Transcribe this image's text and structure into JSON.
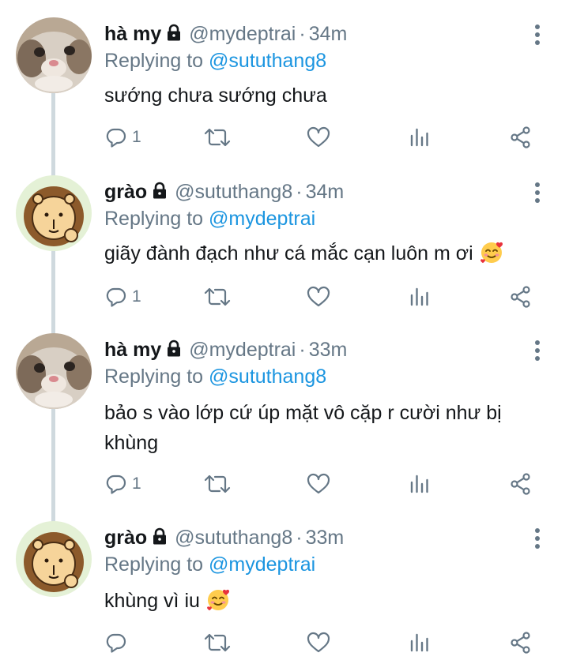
{
  "tweets": [
    {
      "name": "hà my",
      "handle": "@mydeptrai",
      "separator": "·",
      "time": "34m",
      "replying_prefix": "Replying to",
      "replying_to": "@sututhang8",
      "text": "sướng chưa sướng chưa",
      "reply_count": "1",
      "avatar_icon": "cat-avatar-icon"
    },
    {
      "name": "grào",
      "handle": "@sututhang8",
      "separator": "·",
      "time": "34m",
      "replying_prefix": "Replying to",
      "replying_to": "@mydeptrai",
      "text": "giãy đành đạch như cá mắc cạn luôn m ơi",
      "emoji": "smiling-face-with-hearts",
      "reply_count": "1",
      "avatar_icon": "lion-avatar-icon"
    },
    {
      "name": "hà my",
      "handle": "@mydeptrai",
      "separator": "·",
      "time": "33m",
      "replying_prefix": "Replying to",
      "replying_to": "@sututhang8",
      "text": "bảo s vào lớp cứ úp mặt vô cặp r cười như bị khùng",
      "reply_count": "1",
      "avatar_icon": "cat-avatar-icon"
    },
    {
      "name": "grào",
      "handle": "@sututhang8",
      "separator": "·",
      "time": "33m",
      "replying_prefix": "Replying to",
      "replying_to": "@mydeptrai",
      "text": "khùng vì iu",
      "emoji": "smiling-face-with-hearts",
      "reply_count": "",
      "avatar_icon": "lion-avatar-icon"
    }
  ],
  "colors": {
    "text": "#14171a",
    "muted": "#657786",
    "link": "#1b95e0",
    "thread_line": "#cfd9de"
  }
}
